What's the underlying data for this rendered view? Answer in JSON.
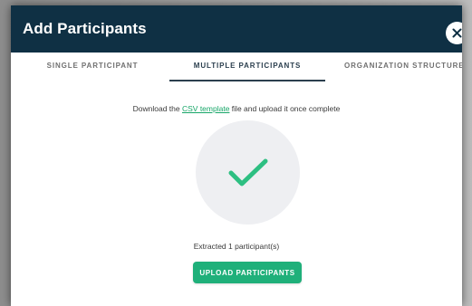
{
  "modal": {
    "title": "Add Participants",
    "close_icon": "close-icon"
  },
  "tabs": [
    {
      "label": "SINGLE PARTICIPANT",
      "active": false
    },
    {
      "label": "MULTIPLE PARTICIPANTS",
      "active": true
    },
    {
      "label": "ORGANIZATION STRUCTURE",
      "active": false
    }
  ],
  "instruction": {
    "prefix": "Download the ",
    "link_text": "CSV template",
    "suffix": " file and upload it once complete"
  },
  "upload_area": {
    "icon": "checkmark-icon"
  },
  "status_text": "Extracted 1 participant(s)",
  "upload_button_label": "UPLOAD PARTICIPANTS",
  "colors": {
    "header_bg": "#0f3044",
    "accent_green": "#1fb07a",
    "link_green": "#17a668",
    "check_green": "#2dbf82",
    "circle_bg": "#eeeff2"
  }
}
